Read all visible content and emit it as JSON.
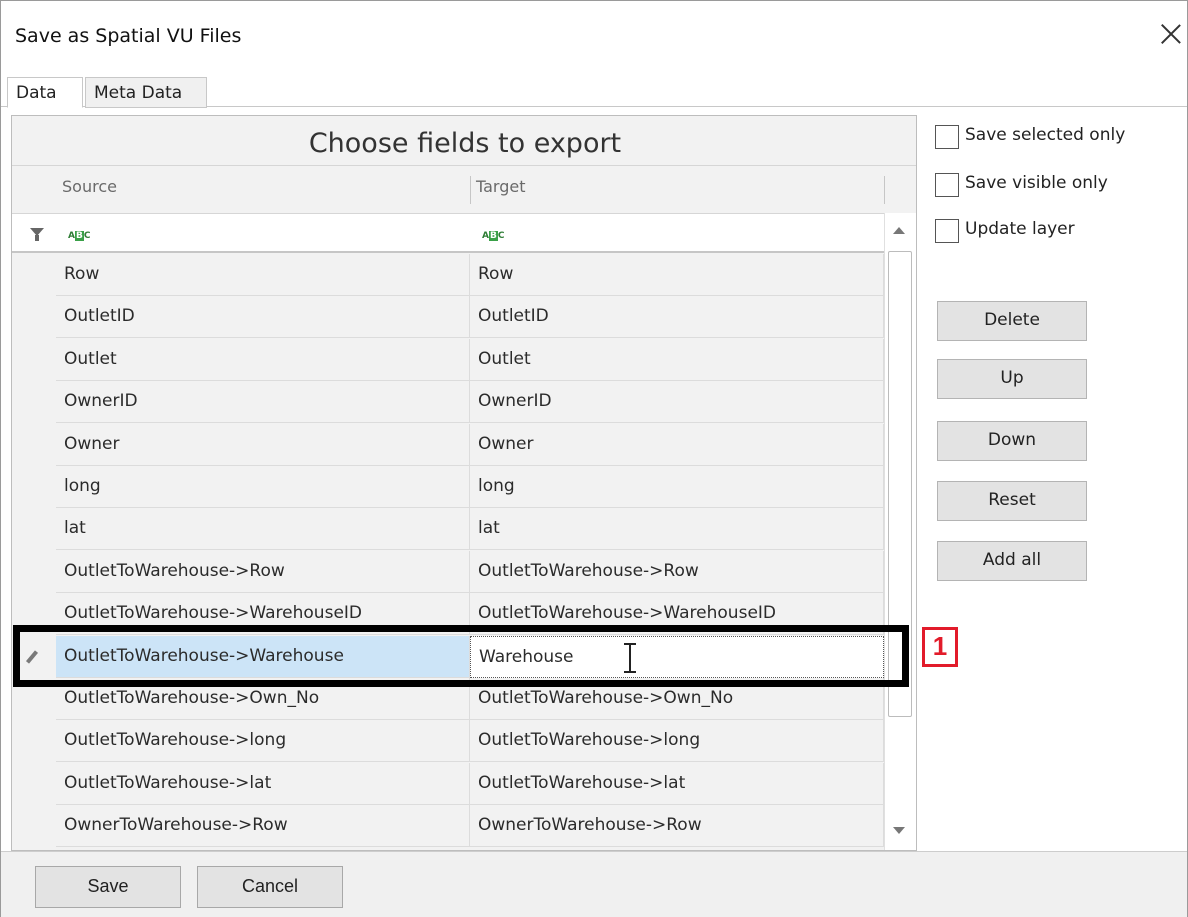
{
  "window": {
    "title": "Save as Spatial VU Files"
  },
  "tabs": [
    {
      "label": "Data"
    },
    {
      "label": "Meta Data"
    }
  ],
  "grid": {
    "title": "Choose fields to export",
    "columns": {
      "source": "Source",
      "target": "Target"
    },
    "rows": [
      {
        "source": "Row",
        "target": "Row"
      },
      {
        "source": "OutletID",
        "target": "OutletID"
      },
      {
        "source": "Outlet",
        "target": "Outlet"
      },
      {
        "source": "OwnerID",
        "target": "OwnerID"
      },
      {
        "source": "Owner",
        "target": "Owner"
      },
      {
        "source": "long",
        "target": "long"
      },
      {
        "source": "lat",
        "target": "lat"
      },
      {
        "source": "OutletToWarehouse->Row",
        "target": "OutletToWarehouse->Row"
      },
      {
        "source": "OutletToWarehouse->WarehouseID",
        "target": "OutletToWarehouse->WarehouseID"
      },
      {
        "source": "OutletToWarehouse->Warehouse",
        "target": "Warehouse"
      },
      {
        "source": "OutletToWarehouse->Own_No",
        "target": "OutletToWarehouse->Own_No"
      },
      {
        "source": "OutletToWarehouse->long",
        "target": "OutletToWarehouse->long"
      },
      {
        "source": "OutletToWarehouse->lat",
        "target": "OutletToWarehouse->lat"
      },
      {
        "source": "OwnerToWarehouse->Row",
        "target": "OwnerToWarehouse->Row"
      }
    ]
  },
  "options": {
    "save_selected_only": "Save selected only",
    "save_visible_only": "Save visible only",
    "update_layer": "Update layer"
  },
  "actions": {
    "delete": "Delete",
    "up": "Up",
    "down": "Down",
    "reset": "Reset",
    "add_all": "Add all"
  },
  "footer": {
    "save": "Save",
    "cancel": "Cancel"
  },
  "annotation": {
    "number": "1"
  }
}
